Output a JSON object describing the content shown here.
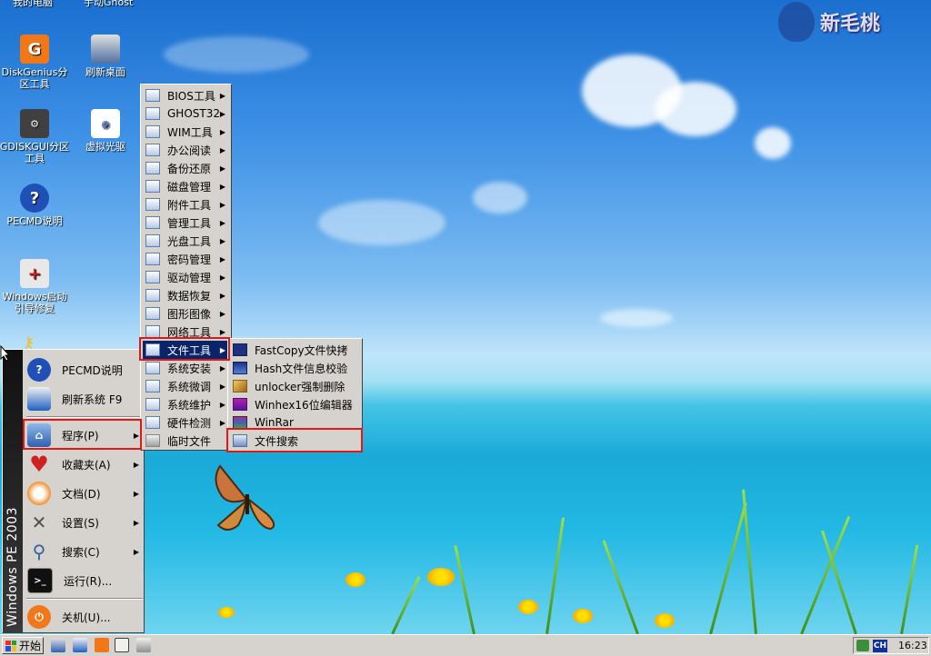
{
  "desktop": {
    "logo_text": "新毛桃",
    "top_clipped": [
      "我的电脑",
      "手动Ghost"
    ],
    "icons": [
      {
        "label": "DiskGenius分区工具",
        "icon": "diskgenius-icon",
        "color": "#f07818"
      },
      {
        "label": "刷新桌面",
        "icon": "refresh-desktop-icon",
        "color": "#5070a0"
      },
      {
        "label": "GDISKGUI分区工具",
        "icon": "gdiskgui-icon",
        "color": "#404040"
      },
      {
        "label": "虚拟光驱",
        "icon": "virtual-cdrom-icon",
        "color": "#8090b0"
      },
      {
        "label": "PECMD说明",
        "icon": "help-icon",
        "color": "#1f50b8"
      },
      {
        "label": "Windows启动引导修复",
        "icon": "first-aid-icon",
        "color": "#e8e8e8"
      }
    ]
  },
  "start_menu": {
    "strip_text": "Windows PE 2003",
    "items": [
      {
        "label": "PECMD说明",
        "icon": "help-icon",
        "arrow": false
      },
      {
        "label": "刷新系统 F9",
        "icon": "brush-icon",
        "arrow": false
      },
      {
        "label": "程序(P)",
        "icon": "programs-icon",
        "arrow": true
      },
      {
        "label": "收藏夹(A)",
        "icon": "favorites-heart-icon",
        "arrow": true
      },
      {
        "label": "文档(D)",
        "icon": "documents-icon",
        "arrow": true
      },
      {
        "label": "设置(S)",
        "icon": "settings-tools-icon",
        "arrow": true
      },
      {
        "label": "搜索(C)",
        "icon": "search-magnifier-icon",
        "arrow": true
      },
      {
        "label": "运行(R)...",
        "icon": "run-console-icon",
        "arrow": false
      },
      {
        "label": "关机(U)...",
        "icon": "shutdown-icon",
        "arrow": false
      }
    ]
  },
  "programs_menu": {
    "items": [
      {
        "label": "BIOS工具",
        "arrow": true
      },
      {
        "label": "GHOST32",
        "arrow": true
      },
      {
        "label": "WIM工具",
        "arrow": true
      },
      {
        "label": "办公阅读",
        "arrow": true
      },
      {
        "label": "备份还原",
        "arrow": true
      },
      {
        "label": "磁盘管理",
        "arrow": true
      },
      {
        "label": "附件工具",
        "arrow": true
      },
      {
        "label": "管理工具",
        "arrow": true
      },
      {
        "label": "光盘工具",
        "arrow": true
      },
      {
        "label": "密码管理",
        "arrow": true
      },
      {
        "label": "驱动管理",
        "arrow": true
      },
      {
        "label": "数据恢复",
        "arrow": true
      },
      {
        "label": "图形图像",
        "arrow": true
      },
      {
        "label": "网络工具",
        "arrow": true
      },
      {
        "label": "文件工具",
        "arrow": true
      },
      {
        "label": "系统安装",
        "arrow": true
      },
      {
        "label": "系统微调",
        "arrow": true
      },
      {
        "label": "系统维护",
        "arrow": true
      },
      {
        "label": "硬件检测",
        "arrow": true
      },
      {
        "label": "临时文件",
        "arrow": false
      }
    ]
  },
  "file_tools_menu": {
    "items": [
      {
        "label": "FastCopy文件快拷",
        "icon": "fastcopy-icon",
        "color": "#203080"
      },
      {
        "label": "Hash文件信息校验",
        "icon": "hash-icon",
        "color": "#3050c0"
      },
      {
        "label": "unlocker强制删除",
        "icon": "unlocker-wand-icon",
        "color": "#e0a030"
      },
      {
        "label": "Winhex16位编辑器",
        "icon": "winhex-icon",
        "color": "#9020a0"
      },
      {
        "label": "WinRar",
        "icon": "winrar-icon",
        "color": "#803080"
      },
      {
        "label": "文件搜索",
        "icon": "file-search-icon",
        "color": "#6080c0"
      }
    ]
  },
  "taskbar": {
    "start_label": "开始",
    "ime": "CH",
    "clock": "16:23"
  }
}
